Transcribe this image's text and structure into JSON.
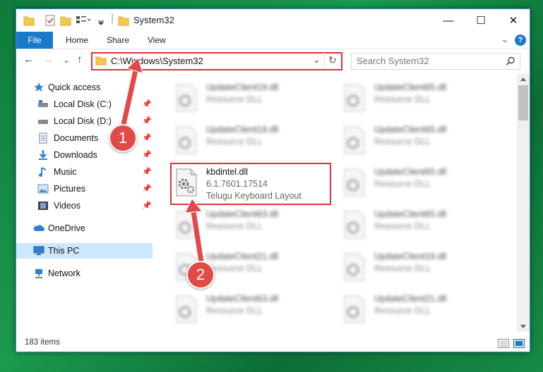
{
  "window": {
    "title": "System32",
    "minimize": "—",
    "maximize": "☐",
    "close": "✕"
  },
  "ribbon": {
    "tabs": [
      "File",
      "Home",
      "Share",
      "View"
    ],
    "help": "?",
    "expand": "⌄"
  },
  "nav": {
    "back": "←",
    "forward": "→",
    "recent": "⌄",
    "up": "↑",
    "address": "C:\\Windows\\System32",
    "dropdown": "⌄",
    "refresh": "↻",
    "search_placeholder": "Search System32"
  },
  "sidebar": {
    "quick_access": "Quick access",
    "items": [
      {
        "label": "Local Disk (C:)",
        "pinned": true
      },
      {
        "label": "Local Disk (D:)",
        "pinned": true
      },
      {
        "label": "Documents",
        "pinned": true
      },
      {
        "label": "Downloads",
        "pinned": true
      },
      {
        "label": "Music",
        "pinned": true
      },
      {
        "label": "Pictures",
        "pinned": true
      },
      {
        "label": "Videos",
        "pinned": true
      }
    ],
    "onedrive": "OneDrive",
    "this_pc": "This PC",
    "network": "Network",
    "pin_glyph": "📌"
  },
  "files": {
    "left_col": [
      {
        "name": "UpdateClient19.dll",
        "desc": "Resource DLL"
      },
      {
        "name": "UpdateClient19.dll",
        "desc": "Resource DLL"
      },
      {
        "name": "UpdateClient63.dll",
        "desc": "Resource DLL"
      },
      {
        "name": "UpdateClient21.dll",
        "desc": "Resource DLL"
      },
      {
        "name": "UpdateClient63.dll",
        "desc": "Resource DLL"
      }
    ],
    "highlighted": {
      "name": "kbdintel.dll",
      "version": "6.1.7601.17514",
      "desc": "Telugu Keyboard Layout"
    },
    "right_col": [
      {
        "name": "UpdateClient65.dll",
        "desc": "Resource DLL"
      },
      {
        "name": "UpdateClient65.dll",
        "desc": "Resource DLL"
      },
      {
        "name": "UpdateClient65.dll",
        "desc": "Resource DLL"
      },
      {
        "name": "UpdateClient65.dll",
        "desc": "Resource DLL"
      },
      {
        "name": "UpdateClient19.dll",
        "desc": "Resource DLL"
      },
      {
        "name": "UpdateClient21.dll",
        "desc": "Resource DLL"
      }
    ]
  },
  "status": {
    "item_count": "183 items"
  },
  "annotations": {
    "step1": "1",
    "step2": "2"
  },
  "colors": {
    "accent": "#1979ca",
    "highlight": "#d9353b",
    "selection": "#cce8ff"
  }
}
